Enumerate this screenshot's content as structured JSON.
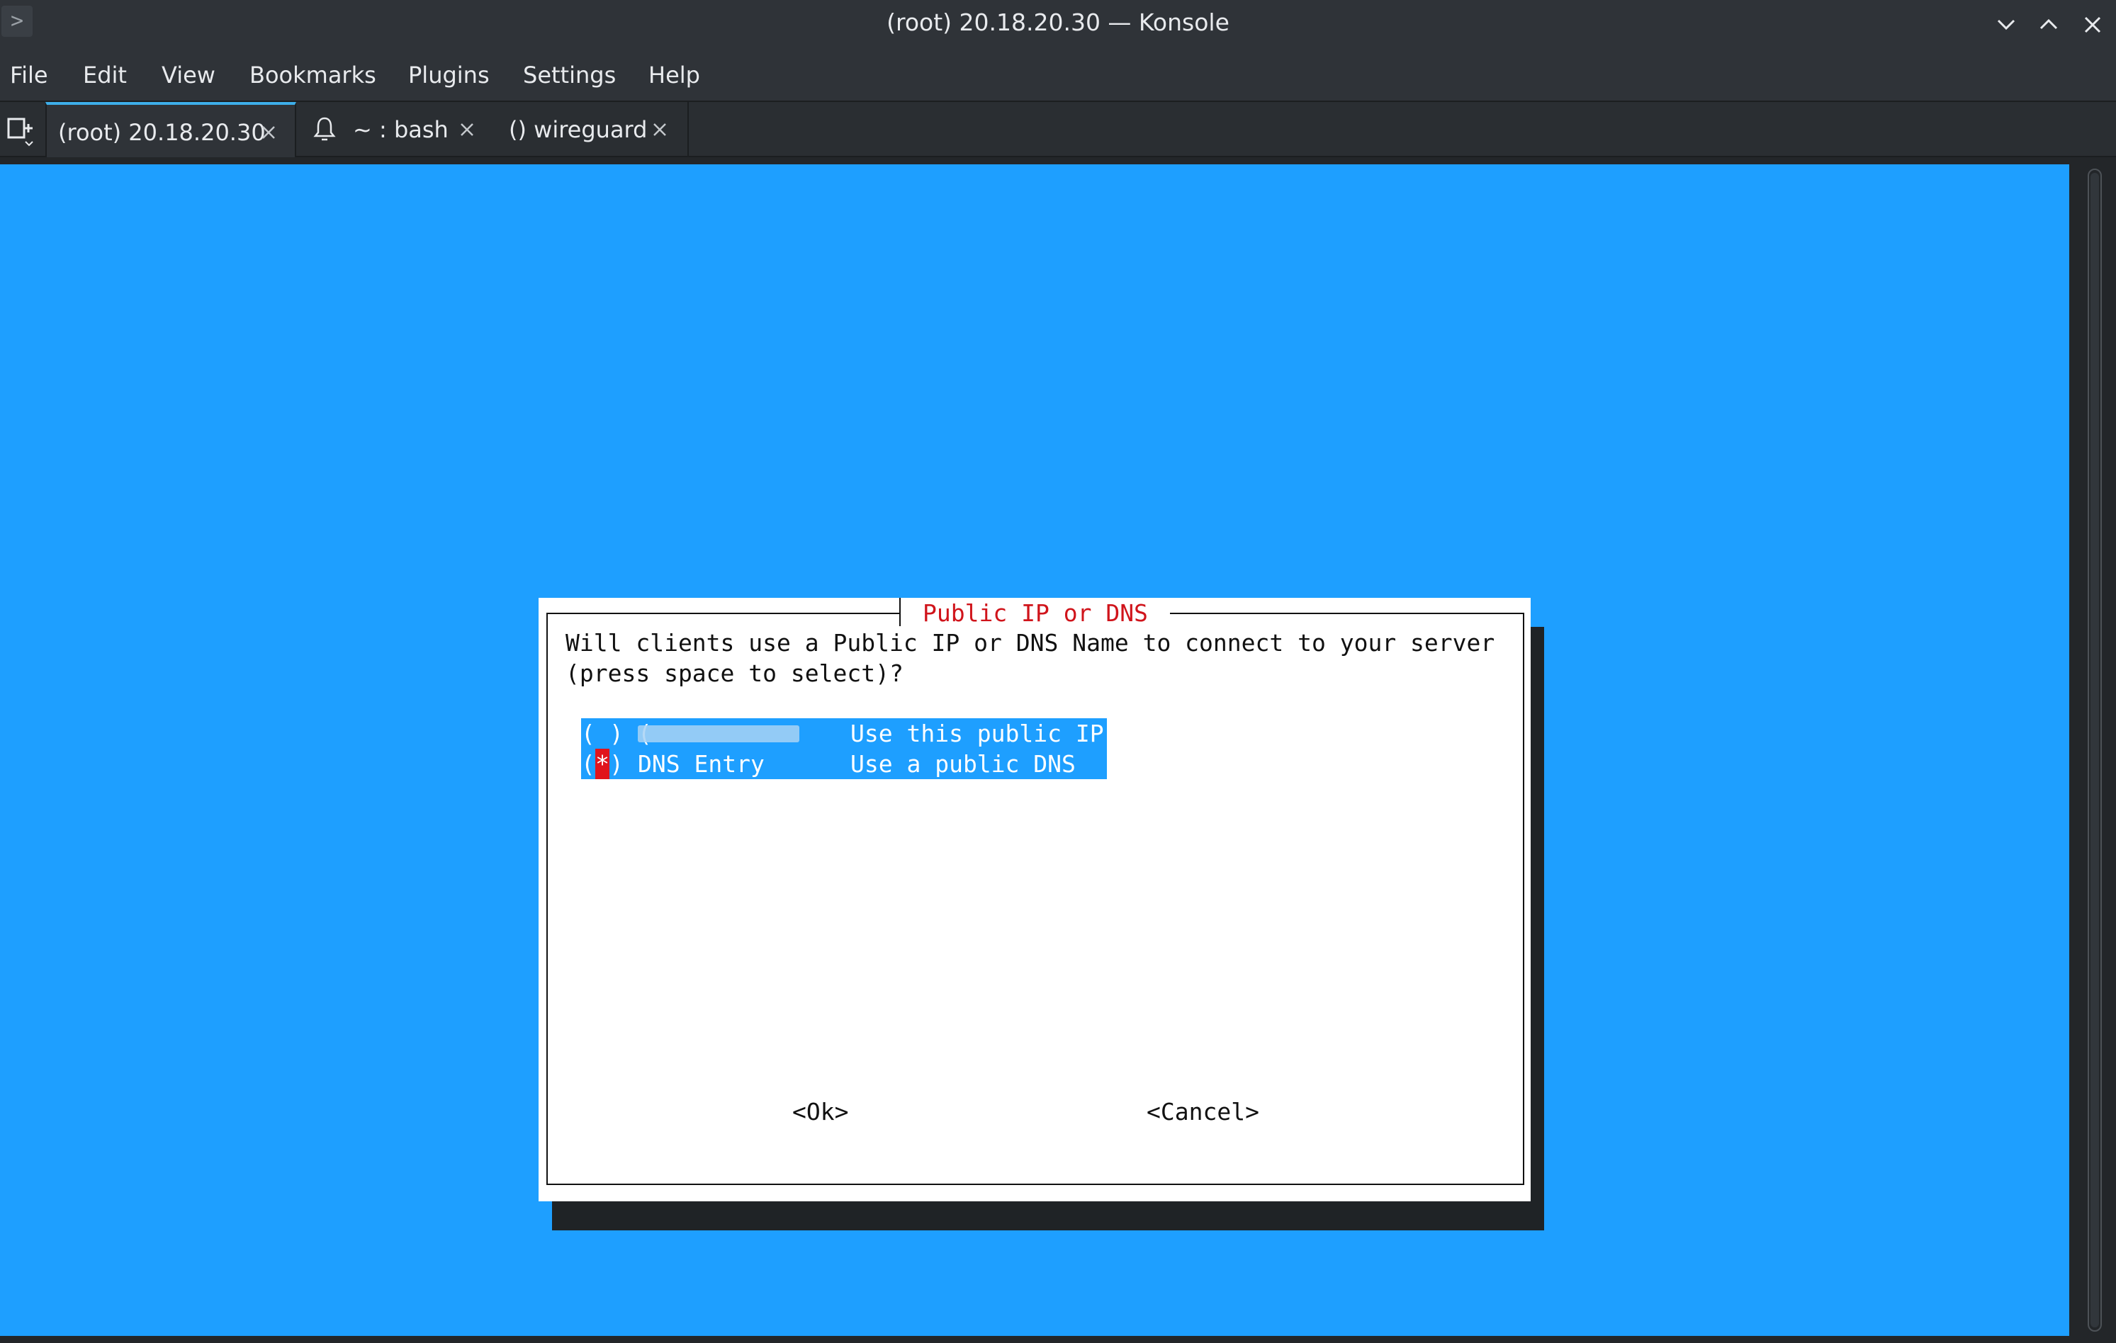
{
  "window": {
    "title": "(root) 20.18.20.30 — Konsole",
    "app_icon": "konsole-prompt-icon"
  },
  "menubar": {
    "items": [
      "File",
      "Edit",
      "View",
      "Bookmarks",
      "Plugins",
      "Settings",
      "Help"
    ]
  },
  "tabs": [
    {
      "label": "(root) 20.18.20.30",
      "active": true
    },
    {
      "label": "~ : bash",
      "icon": "bell-icon",
      "active": false
    },
    {
      "label": "() wireguard",
      "active": false
    }
  ],
  "dialog": {
    "title": "Public IP or DNS",
    "prompt_line_1": "Will clients use a Public IP or DNS Name to connect to your server",
    "prompt_line_2": "(press space to select)?",
    "options": [
      {
        "mark_open": "(",
        "selected": false,
        "mark_close": ")",
        "tag": "(",
        "tag_redacted": true,
        "description": "Use this public IP"
      },
      {
        "mark_open": "(",
        "selected": true,
        "mark_star": "*",
        "mark_close": ")",
        "tag": "DNS Entry",
        "description": "Use a public DNS"
      }
    ],
    "ok_label": "<Ok>",
    "cancel_label": "<Cancel>"
  },
  "colors": {
    "terminal_bg": "#1e9fff",
    "dialog_bg": "#ffffff",
    "title_red": "#d0141b",
    "selected_star_bg": "#e1141c",
    "chrome_bg": "#2f3338",
    "accent": "#3daee9"
  }
}
